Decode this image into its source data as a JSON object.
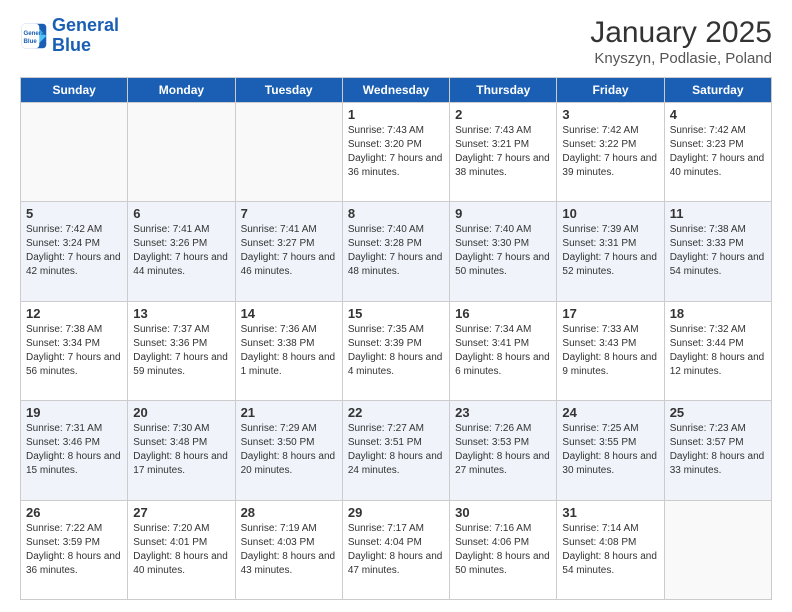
{
  "logo": {
    "line1": "General",
    "line2": "Blue"
  },
  "title": "January 2025",
  "subtitle": "Knyszyn, Podlasie, Poland",
  "days_of_week": [
    "Sunday",
    "Monday",
    "Tuesday",
    "Wednesday",
    "Thursday",
    "Friday",
    "Saturday"
  ],
  "weeks": [
    [
      {
        "day": "",
        "info": ""
      },
      {
        "day": "",
        "info": ""
      },
      {
        "day": "",
        "info": ""
      },
      {
        "day": "1",
        "info": "Sunrise: 7:43 AM\nSunset: 3:20 PM\nDaylight: 7 hours and 36 minutes."
      },
      {
        "day": "2",
        "info": "Sunrise: 7:43 AM\nSunset: 3:21 PM\nDaylight: 7 hours and 38 minutes."
      },
      {
        "day": "3",
        "info": "Sunrise: 7:42 AM\nSunset: 3:22 PM\nDaylight: 7 hours and 39 minutes."
      },
      {
        "day": "4",
        "info": "Sunrise: 7:42 AM\nSunset: 3:23 PM\nDaylight: 7 hours and 40 minutes."
      }
    ],
    [
      {
        "day": "5",
        "info": "Sunrise: 7:42 AM\nSunset: 3:24 PM\nDaylight: 7 hours and 42 minutes."
      },
      {
        "day": "6",
        "info": "Sunrise: 7:41 AM\nSunset: 3:26 PM\nDaylight: 7 hours and 44 minutes."
      },
      {
        "day": "7",
        "info": "Sunrise: 7:41 AM\nSunset: 3:27 PM\nDaylight: 7 hours and 46 minutes."
      },
      {
        "day": "8",
        "info": "Sunrise: 7:40 AM\nSunset: 3:28 PM\nDaylight: 7 hours and 48 minutes."
      },
      {
        "day": "9",
        "info": "Sunrise: 7:40 AM\nSunset: 3:30 PM\nDaylight: 7 hours and 50 minutes."
      },
      {
        "day": "10",
        "info": "Sunrise: 7:39 AM\nSunset: 3:31 PM\nDaylight: 7 hours and 52 minutes."
      },
      {
        "day": "11",
        "info": "Sunrise: 7:38 AM\nSunset: 3:33 PM\nDaylight: 7 hours and 54 minutes."
      }
    ],
    [
      {
        "day": "12",
        "info": "Sunrise: 7:38 AM\nSunset: 3:34 PM\nDaylight: 7 hours and 56 minutes."
      },
      {
        "day": "13",
        "info": "Sunrise: 7:37 AM\nSunset: 3:36 PM\nDaylight: 7 hours and 59 minutes."
      },
      {
        "day": "14",
        "info": "Sunrise: 7:36 AM\nSunset: 3:38 PM\nDaylight: 8 hours and 1 minute."
      },
      {
        "day": "15",
        "info": "Sunrise: 7:35 AM\nSunset: 3:39 PM\nDaylight: 8 hours and 4 minutes."
      },
      {
        "day": "16",
        "info": "Sunrise: 7:34 AM\nSunset: 3:41 PM\nDaylight: 8 hours and 6 minutes."
      },
      {
        "day": "17",
        "info": "Sunrise: 7:33 AM\nSunset: 3:43 PM\nDaylight: 8 hours and 9 minutes."
      },
      {
        "day": "18",
        "info": "Sunrise: 7:32 AM\nSunset: 3:44 PM\nDaylight: 8 hours and 12 minutes."
      }
    ],
    [
      {
        "day": "19",
        "info": "Sunrise: 7:31 AM\nSunset: 3:46 PM\nDaylight: 8 hours and 15 minutes."
      },
      {
        "day": "20",
        "info": "Sunrise: 7:30 AM\nSunset: 3:48 PM\nDaylight: 8 hours and 17 minutes."
      },
      {
        "day": "21",
        "info": "Sunrise: 7:29 AM\nSunset: 3:50 PM\nDaylight: 8 hours and 20 minutes."
      },
      {
        "day": "22",
        "info": "Sunrise: 7:27 AM\nSunset: 3:51 PM\nDaylight: 8 hours and 24 minutes."
      },
      {
        "day": "23",
        "info": "Sunrise: 7:26 AM\nSunset: 3:53 PM\nDaylight: 8 hours and 27 minutes."
      },
      {
        "day": "24",
        "info": "Sunrise: 7:25 AM\nSunset: 3:55 PM\nDaylight: 8 hours and 30 minutes."
      },
      {
        "day": "25",
        "info": "Sunrise: 7:23 AM\nSunset: 3:57 PM\nDaylight: 8 hours and 33 minutes."
      }
    ],
    [
      {
        "day": "26",
        "info": "Sunrise: 7:22 AM\nSunset: 3:59 PM\nDaylight: 8 hours and 36 minutes."
      },
      {
        "day": "27",
        "info": "Sunrise: 7:20 AM\nSunset: 4:01 PM\nDaylight: 8 hours and 40 minutes."
      },
      {
        "day": "28",
        "info": "Sunrise: 7:19 AM\nSunset: 4:03 PM\nDaylight: 8 hours and 43 minutes."
      },
      {
        "day": "29",
        "info": "Sunrise: 7:17 AM\nSunset: 4:04 PM\nDaylight: 8 hours and 47 minutes."
      },
      {
        "day": "30",
        "info": "Sunrise: 7:16 AM\nSunset: 4:06 PM\nDaylight: 8 hours and 50 minutes."
      },
      {
        "day": "31",
        "info": "Sunrise: 7:14 AM\nSunset: 4:08 PM\nDaylight: 8 hours and 54 minutes."
      },
      {
        "day": "",
        "info": ""
      }
    ]
  ]
}
